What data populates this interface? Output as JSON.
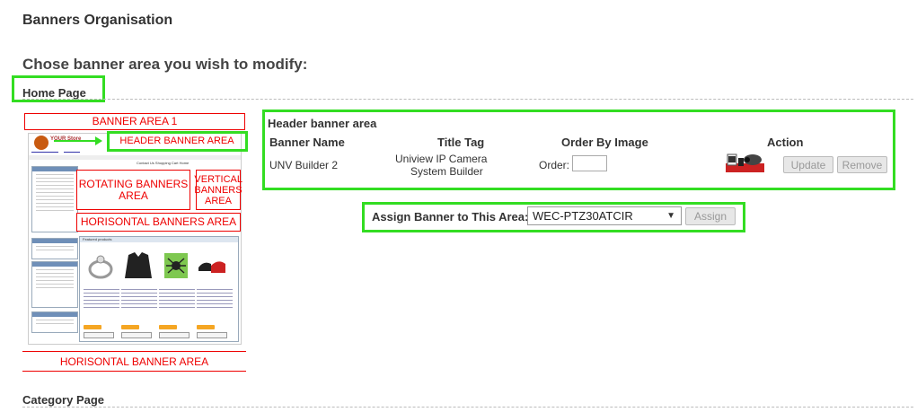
{
  "page": {
    "title": "Banners Organisation",
    "subtitle": "Chose banner area you wish to modify:"
  },
  "sections": {
    "home": "Home Page",
    "category": "Category Page"
  },
  "diagram": {
    "banner_area_1": "BANNER AREA 1",
    "header_banner_area": "HEADER BANNER AREA",
    "rotating_banners_area": "ROTATING BANNERS AREA",
    "vertical_banners_area": "VERTICAL BANNERS AREA",
    "horisontal_banners_area": "HORISONTAL BANNERS AREA",
    "horisontal_banner_area": "HORISONTAL BANNER AREA"
  },
  "preview": {
    "logo_text": "YOUR Store",
    "nav": "Contact Us    Shopping Cart    Home",
    "featured": "Featured products"
  },
  "header_area": {
    "title": "Header banner area",
    "columns": {
      "name": "Banner Name",
      "title_tag": "Title Tag",
      "order": "Order By Image",
      "action": "Action"
    },
    "row": {
      "name": "UNV Builder 2",
      "title_tag_line1": "Uniview IP Camera",
      "title_tag_line2": "System Builder",
      "order_label": "Order:",
      "order_value": "",
      "update": "Update",
      "remove": "Remove"
    }
  },
  "assign": {
    "label": "Assign Banner to This Area:",
    "selected": "WEC-PTZ30ATCIR",
    "button": "Assign"
  },
  "colors": {
    "highlight": "#33dd22",
    "annotation": "#ee0000"
  }
}
